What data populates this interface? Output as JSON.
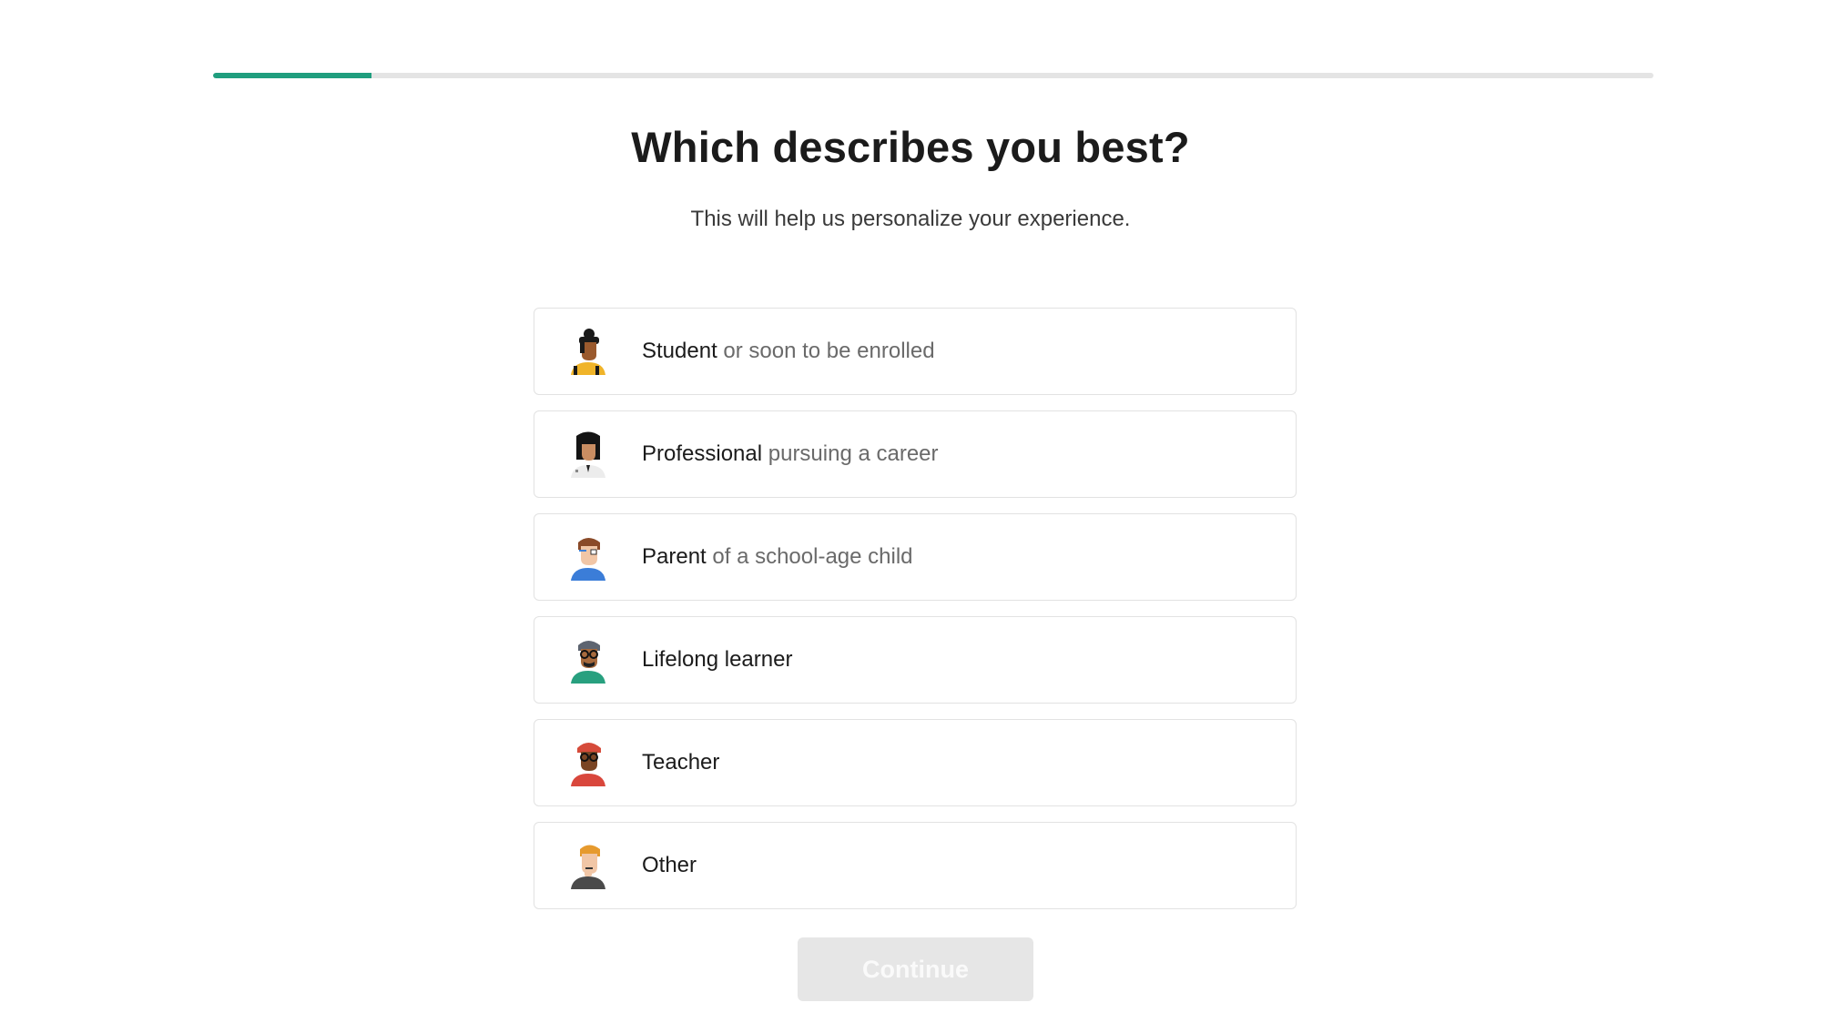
{
  "progress": {
    "fraction": 0.11,
    "color": "#1f9e7e"
  },
  "heading": "Which describes you best?",
  "subheading": "This will help us personalize your experience.",
  "options": [
    {
      "main": "Student",
      "sub": " or soon to be enrolled",
      "icon": "student-avatar-icon"
    },
    {
      "main": "Professional",
      "sub": " pursuing a career",
      "icon": "professional-avatar-icon"
    },
    {
      "main": "Parent",
      "sub": " of a school-age child",
      "icon": "parent-avatar-icon"
    },
    {
      "main": "Lifelong learner",
      "sub": "",
      "icon": "lifelong-learner-avatar-icon"
    },
    {
      "main": "Teacher",
      "sub": "",
      "icon": "teacher-avatar-icon"
    },
    {
      "main": "Other",
      "sub": "",
      "icon": "other-avatar-icon"
    }
  ],
  "continue_label": "Continue"
}
